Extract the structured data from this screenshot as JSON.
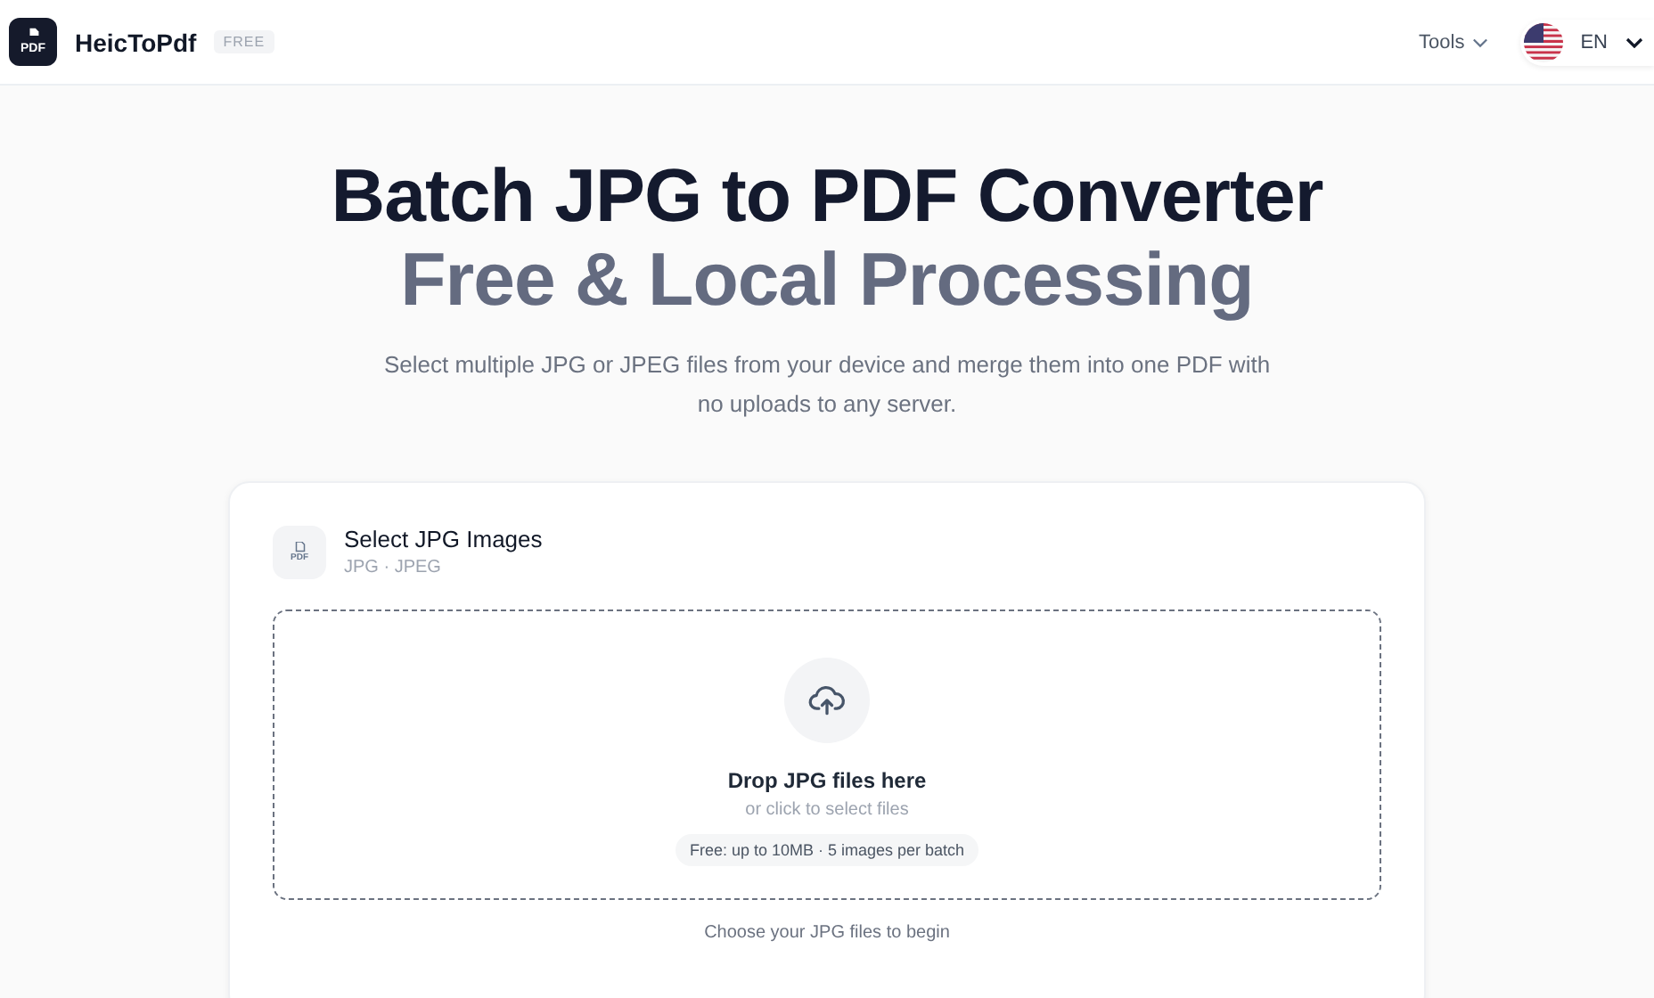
{
  "header": {
    "logo_text": "PDF",
    "brand": "HeicToPdf",
    "badge": "FREE",
    "nav": [
      {
        "label": "Tools",
        "kind": "dropdown"
      }
    ],
    "language": {
      "code": "EN"
    }
  },
  "hero": {
    "title": "Batch JPG to PDF Converter",
    "subtitle": "Free & Local Processing",
    "description": "Select multiple JPG or JPEG files from your device and merge them into one PDF with no uploads to any server."
  },
  "card": {
    "icon_text": "PDF",
    "title": "Select JPG Images",
    "formats": "JPG · JPEG",
    "dropzone": {
      "title": "Drop JPG files here",
      "hint": "or click to select files",
      "limit": "Free: up to 10MB · 5 images per batch"
    },
    "footer": "Choose your JPG files to begin"
  }
}
